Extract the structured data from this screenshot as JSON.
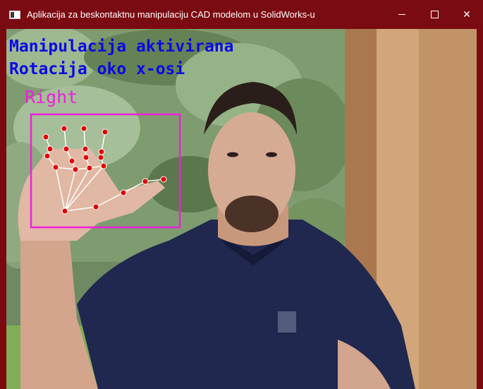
{
  "window": {
    "title": "Aplikacija za beskontaktnu manipulaciju CAD modelom u SolidWorks-u",
    "minimize_glyph": "─",
    "maximize_glyph": "☐",
    "close_glyph": "✕",
    "titlebar_color": "#7b0b12"
  },
  "overlay": {
    "status_line_1": "Manipulacija aktivirana",
    "status_line_2": "Rotacija oko x-osi",
    "hand_label": "Right",
    "status_color": "#0a0ae6",
    "hand_color": "#ef1fe0",
    "landmark_color": "#e10000",
    "connection_color": "#ffffff"
  },
  "icons": {
    "app": "window-app-icon",
    "minimize": "minimize-icon",
    "maximize": "maximize-icon",
    "close": "close-icon"
  }
}
